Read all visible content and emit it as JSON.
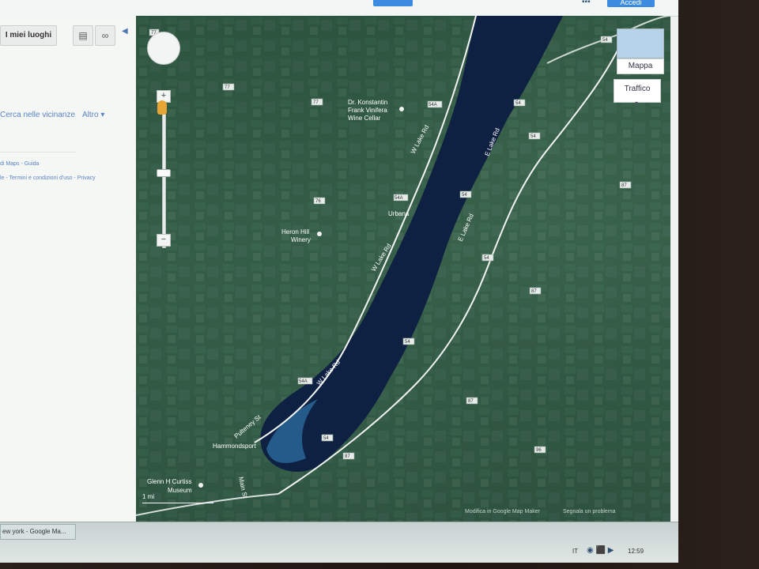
{
  "header": {
    "signin_label": "Accedi"
  },
  "sidebar": {
    "places_label": "I miei luoghi",
    "nearby_label": "Cerca nelle vicinanze",
    "more_label": "Altro",
    "footer_line1": "di Maps - Guida",
    "footer_line2": "le - Termini e condizioni d'uso - Privacy"
  },
  "map": {
    "map_type_label": "Mappa",
    "traffic_label": "Traffico",
    "scale_label": "1 mi",
    "mapmaker_label": "Modifica in Google Map Maker",
    "report_label": "Segnala un problema",
    "places": {
      "konstantin_line1": "Dr. Konstantin",
      "konstantin_line2": "Frank Vinifera",
      "konstantin_line3": "Wine Cellar",
      "heron_line1": "Heron Hill",
      "heron_line2": "Winery",
      "urbana": "Urbana",
      "hammondsport": "Hammondsport",
      "glenn_line1": "Glenn H Curtiss",
      "glenn_line2": "Museum"
    },
    "roads": {
      "w_lake_rd": "W Lake Rd",
      "e_lake_rd": "E Lake Rd",
      "pulteney_st": "Pulteney St",
      "main_st": "Main St"
    },
    "route_labels": [
      "77",
      "77",
      "77",
      "76",
      "54A",
      "54A",
      "54A",
      "54",
      "54",
      "54",
      "54",
      "54",
      "54",
      "54",
      "87",
      "87",
      "87",
      "87",
      "96"
    ]
  },
  "taskbar": {
    "task_label": "ew york - Google Ma...",
    "lang": "IT",
    "clock": "12:59"
  }
}
